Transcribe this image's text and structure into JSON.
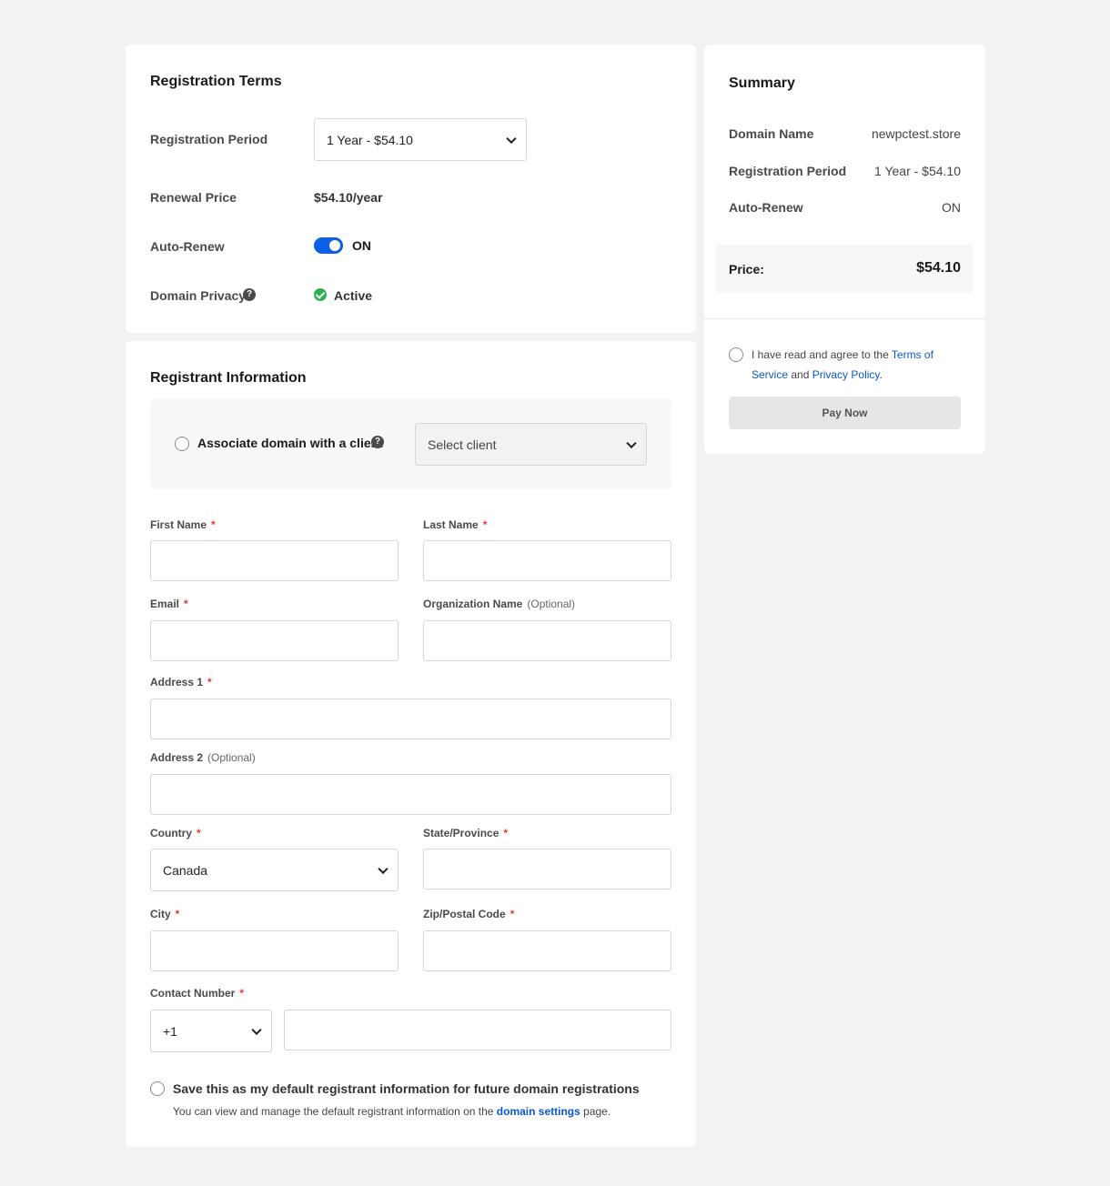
{
  "terms": {
    "title": "Registration Terms",
    "period_label": "Registration Period",
    "period_value": "1 Year - $54.10",
    "renewal_label": "Renewal Price",
    "renewal_value": "$54.10/year",
    "autorenew_label": "Auto-Renew",
    "autorenew_state": "ON",
    "privacy_label": "Domain Privacy",
    "privacy_status": "Active",
    "help_glyph": "?"
  },
  "registrant": {
    "title": "Registrant Information",
    "associate_label": "Associate domain with a client",
    "client_select": "Select client",
    "first_name": "First Name",
    "last_name": "Last Name",
    "email": "Email",
    "org_name": "Organization Name",
    "address1": "Address 1",
    "address2": "Address 2",
    "country": "Country",
    "country_value": "Canada",
    "state": "State/Province",
    "city": "City",
    "zip": "Zip/Postal Code",
    "contact": "Contact Number",
    "dial_code": "+1",
    "required_mark": "*",
    "optional_mark": "(Optional)",
    "save_default_label": "Save this as my default registrant information for future domain registrations",
    "save_default_note_pre": "You can view and manage the default registrant information on the ",
    "save_default_link": "domain settings",
    "save_default_note_post": " page."
  },
  "summary": {
    "title": "Summary",
    "domain_label": "Domain Name",
    "domain_value": "newpctest.store",
    "period_label": "Registration Period",
    "period_value": "1 Year - $54.10",
    "autorenew_label": "Auto-Renew",
    "autorenew_value": "ON",
    "price_label": "Price:",
    "price_value": "$54.10",
    "agree_pre": "I have read and agree to the ",
    "terms_link": "Terms of Service",
    "agree_mid": " and ",
    "privacy_link": "Privacy Policy",
    "agree_post": ".",
    "pay_button": "Pay Now"
  },
  "colors": {
    "accent": "#0d5fe8",
    "link": "#0b57d0",
    "required": "#e0393e",
    "success": "#2bb24c",
    "background": "#f2f2f2"
  }
}
